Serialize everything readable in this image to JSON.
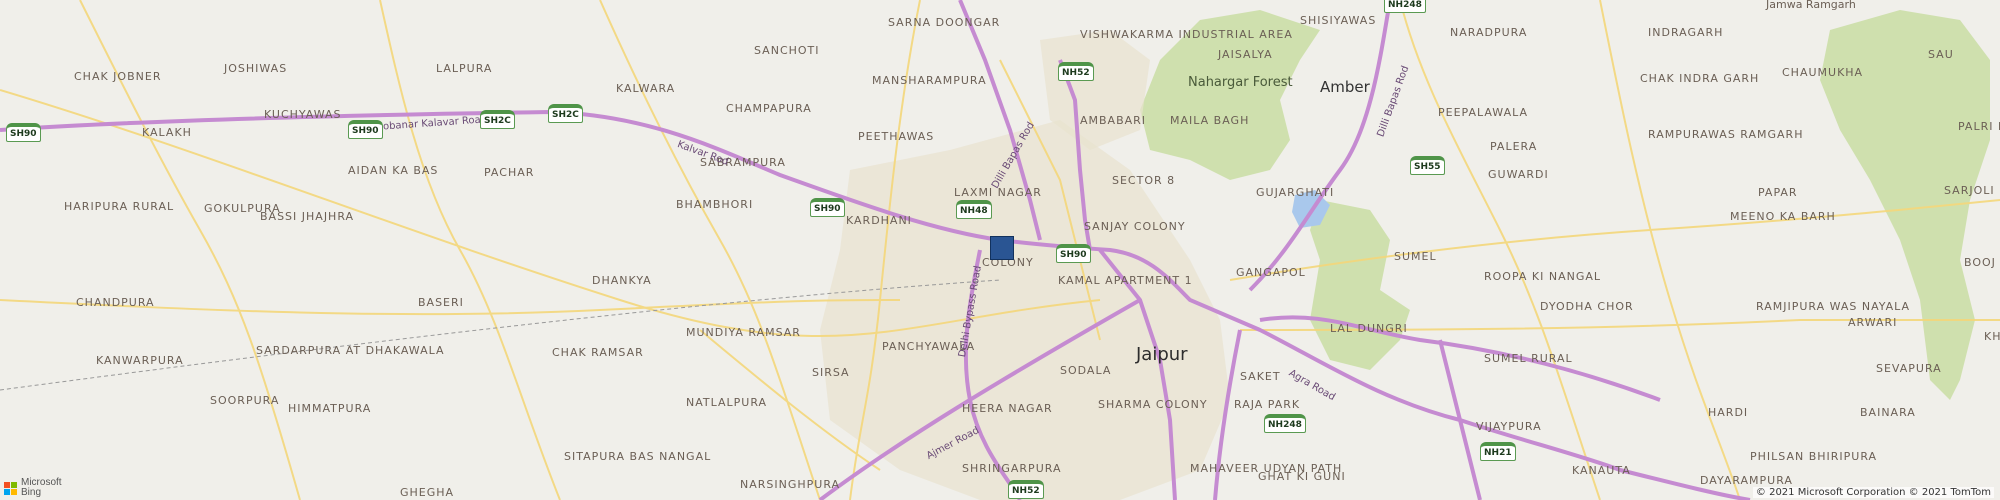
{
  "map": {
    "city": "Jaipur",
    "places": [
      "Amber",
      "Sarna Doongar",
      "Vishwakarma Industrial Area",
      "Shisiyawas",
      "Naradpura",
      "Indragarh",
      "Joshiwas",
      "Lalpura",
      "Sanchoti",
      "Jaisalya",
      "Chak Jobner",
      "Kalwara",
      "Mansharampura",
      "Chak Indra Garh",
      "Chaumukha",
      "Sau",
      "Kalakh",
      "Kuchyawas",
      "Champapura",
      "Ambabari",
      "Maila Bagh",
      "Peepalawala",
      "Palri K",
      "Aidan Ka Bas",
      "Pachar",
      "Peethawas",
      "Rampurawas Ramgarh",
      "Sabrampura",
      "Palera",
      "Guwardi",
      "Sector 8",
      "Haripura Rural",
      "Gokulpura",
      "Bhambhori",
      "Laxmi Nagar",
      "Gujarghati",
      "Papar",
      "Sarjoli",
      "Kardhani",
      "Sanjay Colony",
      "Bassi Jhajhra",
      "Meeno Ka Barh",
      "Colony",
      "Kamal Apartment 1",
      "Sumel",
      "Dhankya",
      "Gangapol",
      "Roopa Ki Nangal",
      "Booj",
      "Chandpura",
      "Baseri",
      "Dyodha Chor",
      "Ramjipura Was Nayala",
      "Arwari",
      "Mundiya Ramsar",
      "Lal Dungri",
      "Kanwarpura",
      "Chak Ramsar",
      "Panchyawala",
      "Sardarpura At Dhakawala",
      "Sumel Rural",
      "Kh",
      "Sirsa",
      "Sodala",
      "Saket",
      "Sevapura",
      "Soorpura",
      "Sharma Colony",
      "Raja Park",
      "Himmatpura",
      "Natlalpura",
      "Heera Nagar",
      "Hardi",
      "Bainara",
      "Vijaypura",
      "Sitapura Bas Nangal",
      "Philsan Bhiripura",
      "Shringarpura",
      "Mahaveer Udyan Path",
      "Ghat Ki Guni",
      "Dayarampura",
      "Narsinghpura",
      "Kanauta",
      "Ghegha",
      "Jamwa Ramgarh"
    ],
    "forests": [
      "Nahargar Forest"
    ],
    "roads": [
      "Jobanar Kalavar Road",
      "Kalvar Rod",
      "Dilli Bapas Rod",
      "Delhi Bypass Road",
      "Ajmer Road",
      "Agra Road",
      "Dilli Bapas Rod"
    ],
    "shields": [
      "SH90",
      "SH90",
      "SH2C",
      "SH2C",
      "SH90",
      "NH48",
      "SH90",
      "NH52",
      "NH248",
      "SH55",
      "NH248",
      "NH21",
      "NH52"
    ]
  },
  "attribution": {
    "copyright": "© 2021 Microsoft Corporation © 2021 TomTom",
    "brand_line1": "Microsoft",
    "brand_line2": "Bing"
  },
  "colors": {
    "background": "#f0efea",
    "forest": "#cfe0ae",
    "water": "#a9c8ec",
    "urban": "#e8e2cf",
    "major_road": "#c58bd1",
    "minor_road": "#f4d77b",
    "pin": "#2a5593"
  }
}
